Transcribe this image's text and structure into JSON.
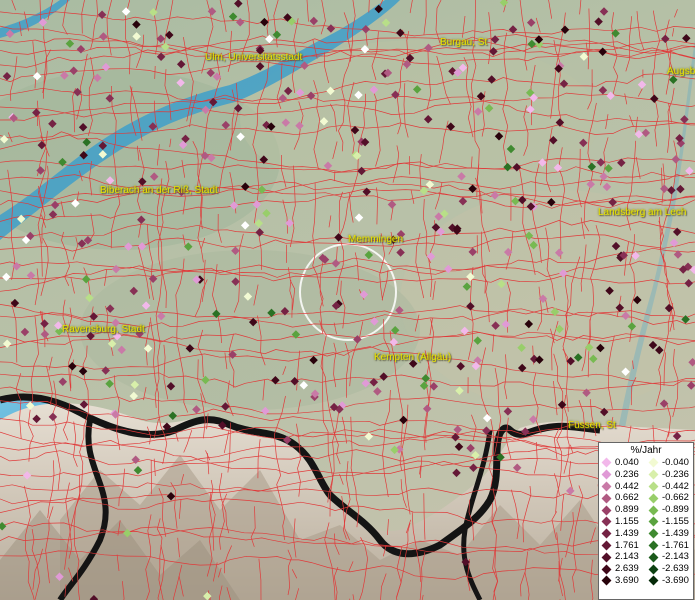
{
  "cities": [
    {
      "name": "Ulm, Universitätsstadt",
      "anchor": "Ulm"
    },
    {
      "name": "Burgau, St",
      "anchor": "Burgau"
    },
    {
      "name": "Augsb",
      "anchor": "Augsburg"
    },
    {
      "name": "Biberach an der Riß, Stadt",
      "anchor": "Biberach"
    },
    {
      "name": "Memmingen",
      "anchor": "Memmingen"
    },
    {
      "name": "Landsberg am Lech",
      "anchor": "Landsberg"
    },
    {
      "name": "Ravensburg, Stadt",
      "anchor": "Ravensburg"
    },
    {
      "name": "Kempten (Allgäu)",
      "anchor": "Kempten"
    },
    {
      "name": "Füssen, St",
      "anchor": "Fuessen"
    }
  ],
  "legend": {
    "title": "%/Jahr",
    "positive": [
      {
        "label": "0.040",
        "color": "#f2b8ea"
      },
      {
        "label": "0.236",
        "color": "#e09ad6"
      },
      {
        "label": "0.442",
        "color": "#c97aa7"
      },
      {
        "label": "0.662",
        "color": "#b05a82"
      },
      {
        "label": "0.899",
        "color": "#9a4068"
      },
      {
        "label": "1.155",
        "color": "#873055"
      },
      {
        "label": "1.439",
        "color": "#752244"
      },
      {
        "label": "1.761",
        "color": "#641836"
      },
      {
        "label": "2.143",
        "color": "#520f28"
      },
      {
        "label": "2.639",
        "color": "#3f0719"
      },
      {
        "label": "3.690",
        "color": "#28020b"
      }
    ],
    "negative": [
      {
        "label": "-0.040",
        "color": "#f2fad2"
      },
      {
        "label": "-0.236",
        "color": "#d8efaa"
      },
      {
        "label": "-0.442",
        "color": "#b8df88"
      },
      {
        "label": "-0.662",
        "color": "#98ce6a"
      },
      {
        "label": "-0.899",
        "color": "#78ba52"
      },
      {
        "label": "-1.155",
        "color": "#5aa33f"
      },
      {
        "label": "-1.439",
        "color": "#3f8a30"
      },
      {
        "label": "-1.761",
        "color": "#2a7124"
      },
      {
        "label": "-2.143",
        "color": "#1a5a1a"
      },
      {
        "label": "-2.639",
        "color": "#0d4212"
      },
      {
        "label": "-3.690",
        "color": "#052a08"
      }
    ]
  },
  "colors": {
    "boundary": "#e03a3a",
    "river": "#3f9fc9",
    "lake": "#5ab4d8",
    "mountains": "#d9d3c8",
    "border": "#141414",
    "city_label": "#e8e200",
    "highlight_circle": "#ffffff"
  },
  "stations": [
    {
      "class": 9,
      "pos": "a"
    }
  ]
}
